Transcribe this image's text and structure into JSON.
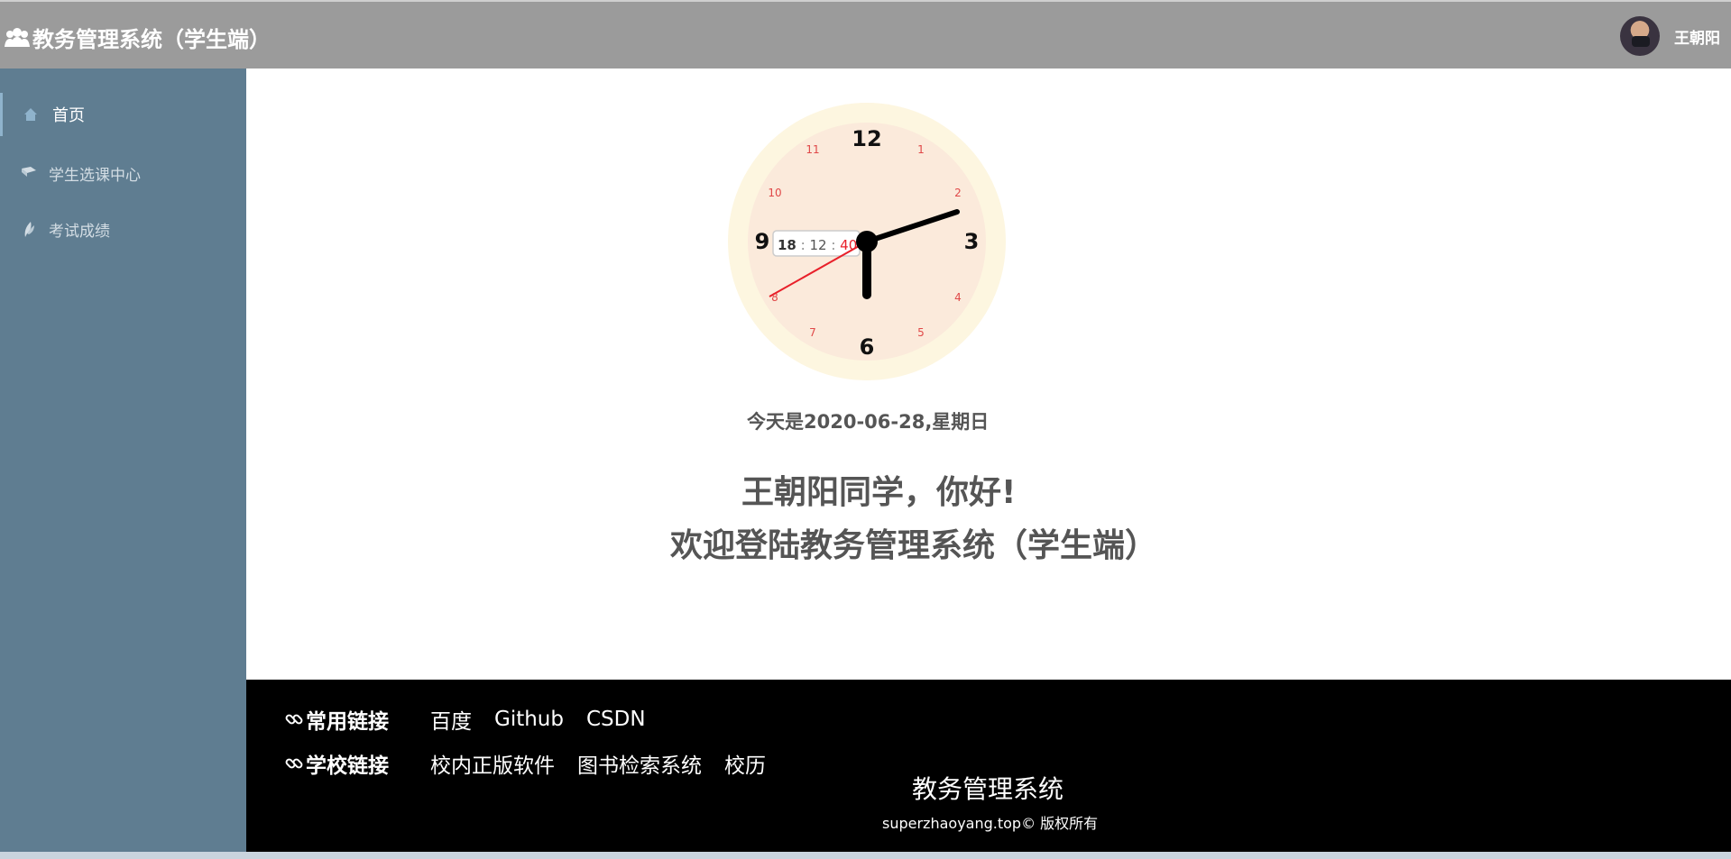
{
  "header": {
    "brand_icon": "users-icon",
    "title": "教务管理系统（学生端）",
    "user_name": "王朝阳"
  },
  "sidebar": {
    "items": [
      {
        "label": "首页",
        "icon": "home-icon",
        "active": true
      },
      {
        "label": "学生选课中心",
        "icon": "book-icon",
        "active": false
      },
      {
        "label": "考试成绩",
        "icon": "leaf-icon",
        "active": false
      }
    ]
  },
  "clock": {
    "numbers_major": [
      "12",
      "3",
      "6",
      "9"
    ],
    "numbers_minor": [
      "1",
      "2",
      "4",
      "5",
      "7",
      "8",
      "10",
      "11"
    ],
    "digital": {
      "hours": "18",
      "minutes": "12",
      "seconds": "40"
    }
  },
  "main": {
    "date_line": "今天是2020-06-28,星期日",
    "greeting_line1": "王朝阳同学，你好!",
    "greeting_line2": "欢迎登陆教务管理系统（学生端）"
  },
  "footer": {
    "common_links_title": "常用链接",
    "common_links": [
      "百度",
      "Github",
      "CSDN"
    ],
    "school_links_title": "学校链接",
    "school_links": [
      "校内正版软件",
      "图书检索系统",
      "校历"
    ],
    "system_name": "教务管理系统",
    "copyright": "superzhaoyang.top© 版权所有"
  },
  "colors": {
    "header_bg": "#9b9b9b",
    "sidebar_bg": "#5f7d91",
    "footer_bg": "#000000",
    "clock_outer": "#fdf6e0",
    "clock_face": "#fbeadb",
    "second_hand": "#e8202a"
  }
}
